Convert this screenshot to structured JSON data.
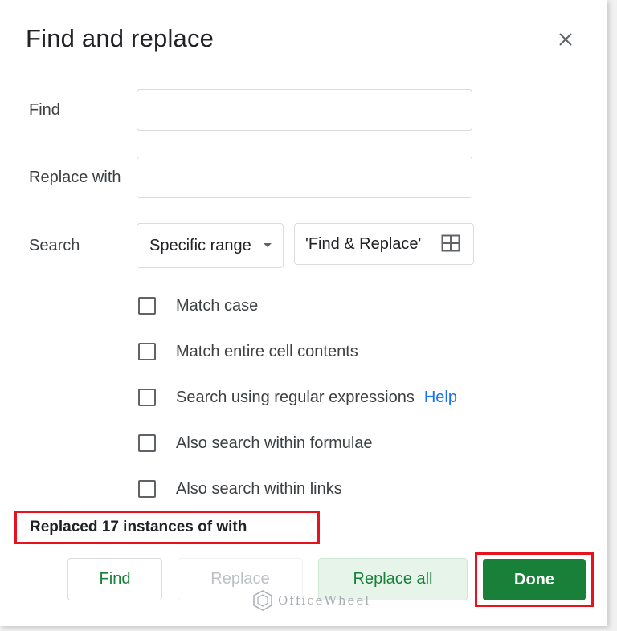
{
  "dialog": {
    "title": "Find and replace"
  },
  "form": {
    "find_label": "Find",
    "find_value": "",
    "replace_label": "Replace with",
    "replace_value": "",
    "search_label": "Search",
    "search_scope": "Specific range",
    "range_value": "'Find & Replace'"
  },
  "options": {
    "match_case": {
      "label": "Match case",
      "checked": false
    },
    "match_entire": {
      "label": "Match entire cell contents",
      "checked": false
    },
    "regex": {
      "label": "Search using regular expressions",
      "checked": false
    },
    "regex_help": "Help",
    "formulae": {
      "label": "Also search within formulae",
      "checked": false
    },
    "links": {
      "label": "Also search within links",
      "checked": false
    }
  },
  "status": {
    "message": "Replaced 17 instances of with"
  },
  "buttons": {
    "find": "Find",
    "replace": "Replace",
    "replace_all": "Replace all",
    "done": "Done"
  },
  "watermark": {
    "text": "OfficeWheel"
  },
  "colors": {
    "accent_green": "#188038",
    "link_blue": "#1a73e8",
    "highlight_red": "#e8121d"
  },
  "icons": {
    "close": "close-icon",
    "dropdown": "chevron-down-icon",
    "range_picker": "grid-icon"
  }
}
